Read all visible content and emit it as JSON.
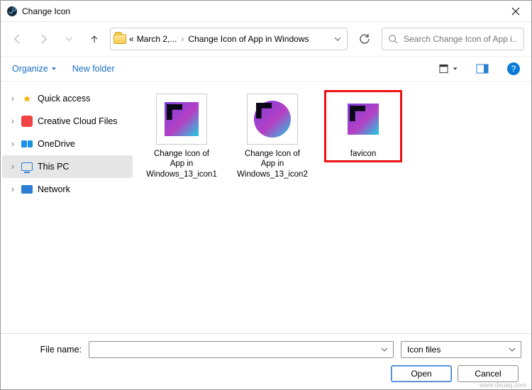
{
  "title": "Change Icon",
  "breadcrumbs": {
    "a": "«",
    "b": "March 2,...",
    "c": "Change Icon of App in Windows"
  },
  "search": {
    "placeholder": "Search Change Icon of App i..."
  },
  "toolbar": {
    "organize": "Organize",
    "new_folder": "New folder"
  },
  "tree": {
    "quick_access": "Quick access",
    "creative_cloud": "Creative Cloud Files",
    "onedrive": "OneDrive",
    "this_pc": "This PC",
    "network": "Network"
  },
  "files": [
    {
      "name": "Change Icon of App in Windows_13_icon1"
    },
    {
      "name": "Change Icon of App in Windows_13_icon2"
    },
    {
      "name": "favicon"
    }
  ],
  "footer": {
    "file_name_label": "File name:",
    "file_name_value": "",
    "filter": "Icon files",
    "open": "Open",
    "cancel": "Cancel"
  },
  "watermark": "www.deuaq.com"
}
